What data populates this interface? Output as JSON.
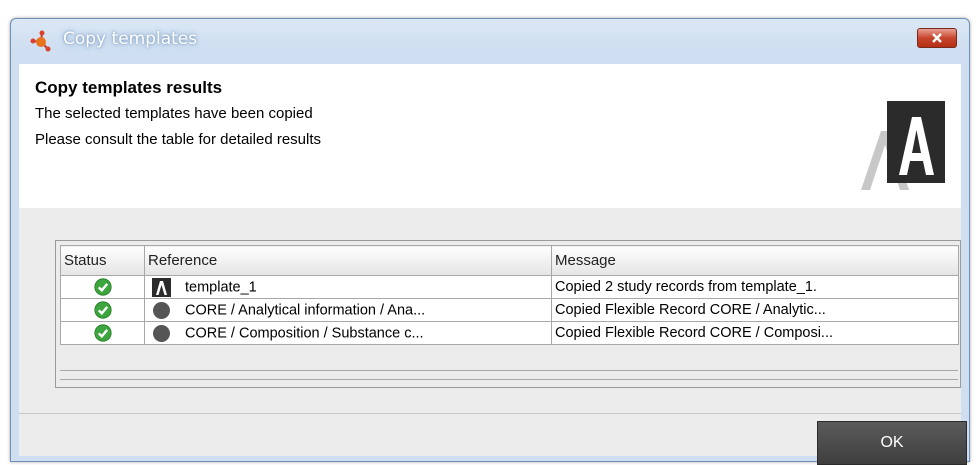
{
  "window": {
    "title": "Copy templates",
    "icons": {
      "app": "molecule-icon",
      "close": "close-icon"
    }
  },
  "header": {
    "title": "Copy templates results",
    "line1": "The selected templates have been copied",
    "line2": "Please consult the table for detailed results",
    "logo": "brand-logo-icon"
  },
  "table": {
    "columns": {
      "status": "Status",
      "reference": "Reference",
      "message": "Message"
    },
    "rows": [
      {
        "status": "success",
        "ref_icon": "template-icon",
        "reference": "template_1",
        "message": "Copied 2 study records from template_1."
      },
      {
        "status": "success",
        "ref_icon": "record-circle-icon",
        "reference": "CORE / Analytical information / Ana...",
        "message": "Copied Flexible Record CORE / Analytic..."
      },
      {
        "status": "success",
        "ref_icon": "record-circle-icon",
        "reference": "CORE / Composition / Substance c...",
        "message": "Copied Flexible Record CORE / Composi..."
      }
    ]
  },
  "footer": {
    "ok_label": "OK"
  },
  "colors": {
    "success": "#3da53d",
    "title_bar": "#cfdff1",
    "button": "#4a4a4a"
  }
}
